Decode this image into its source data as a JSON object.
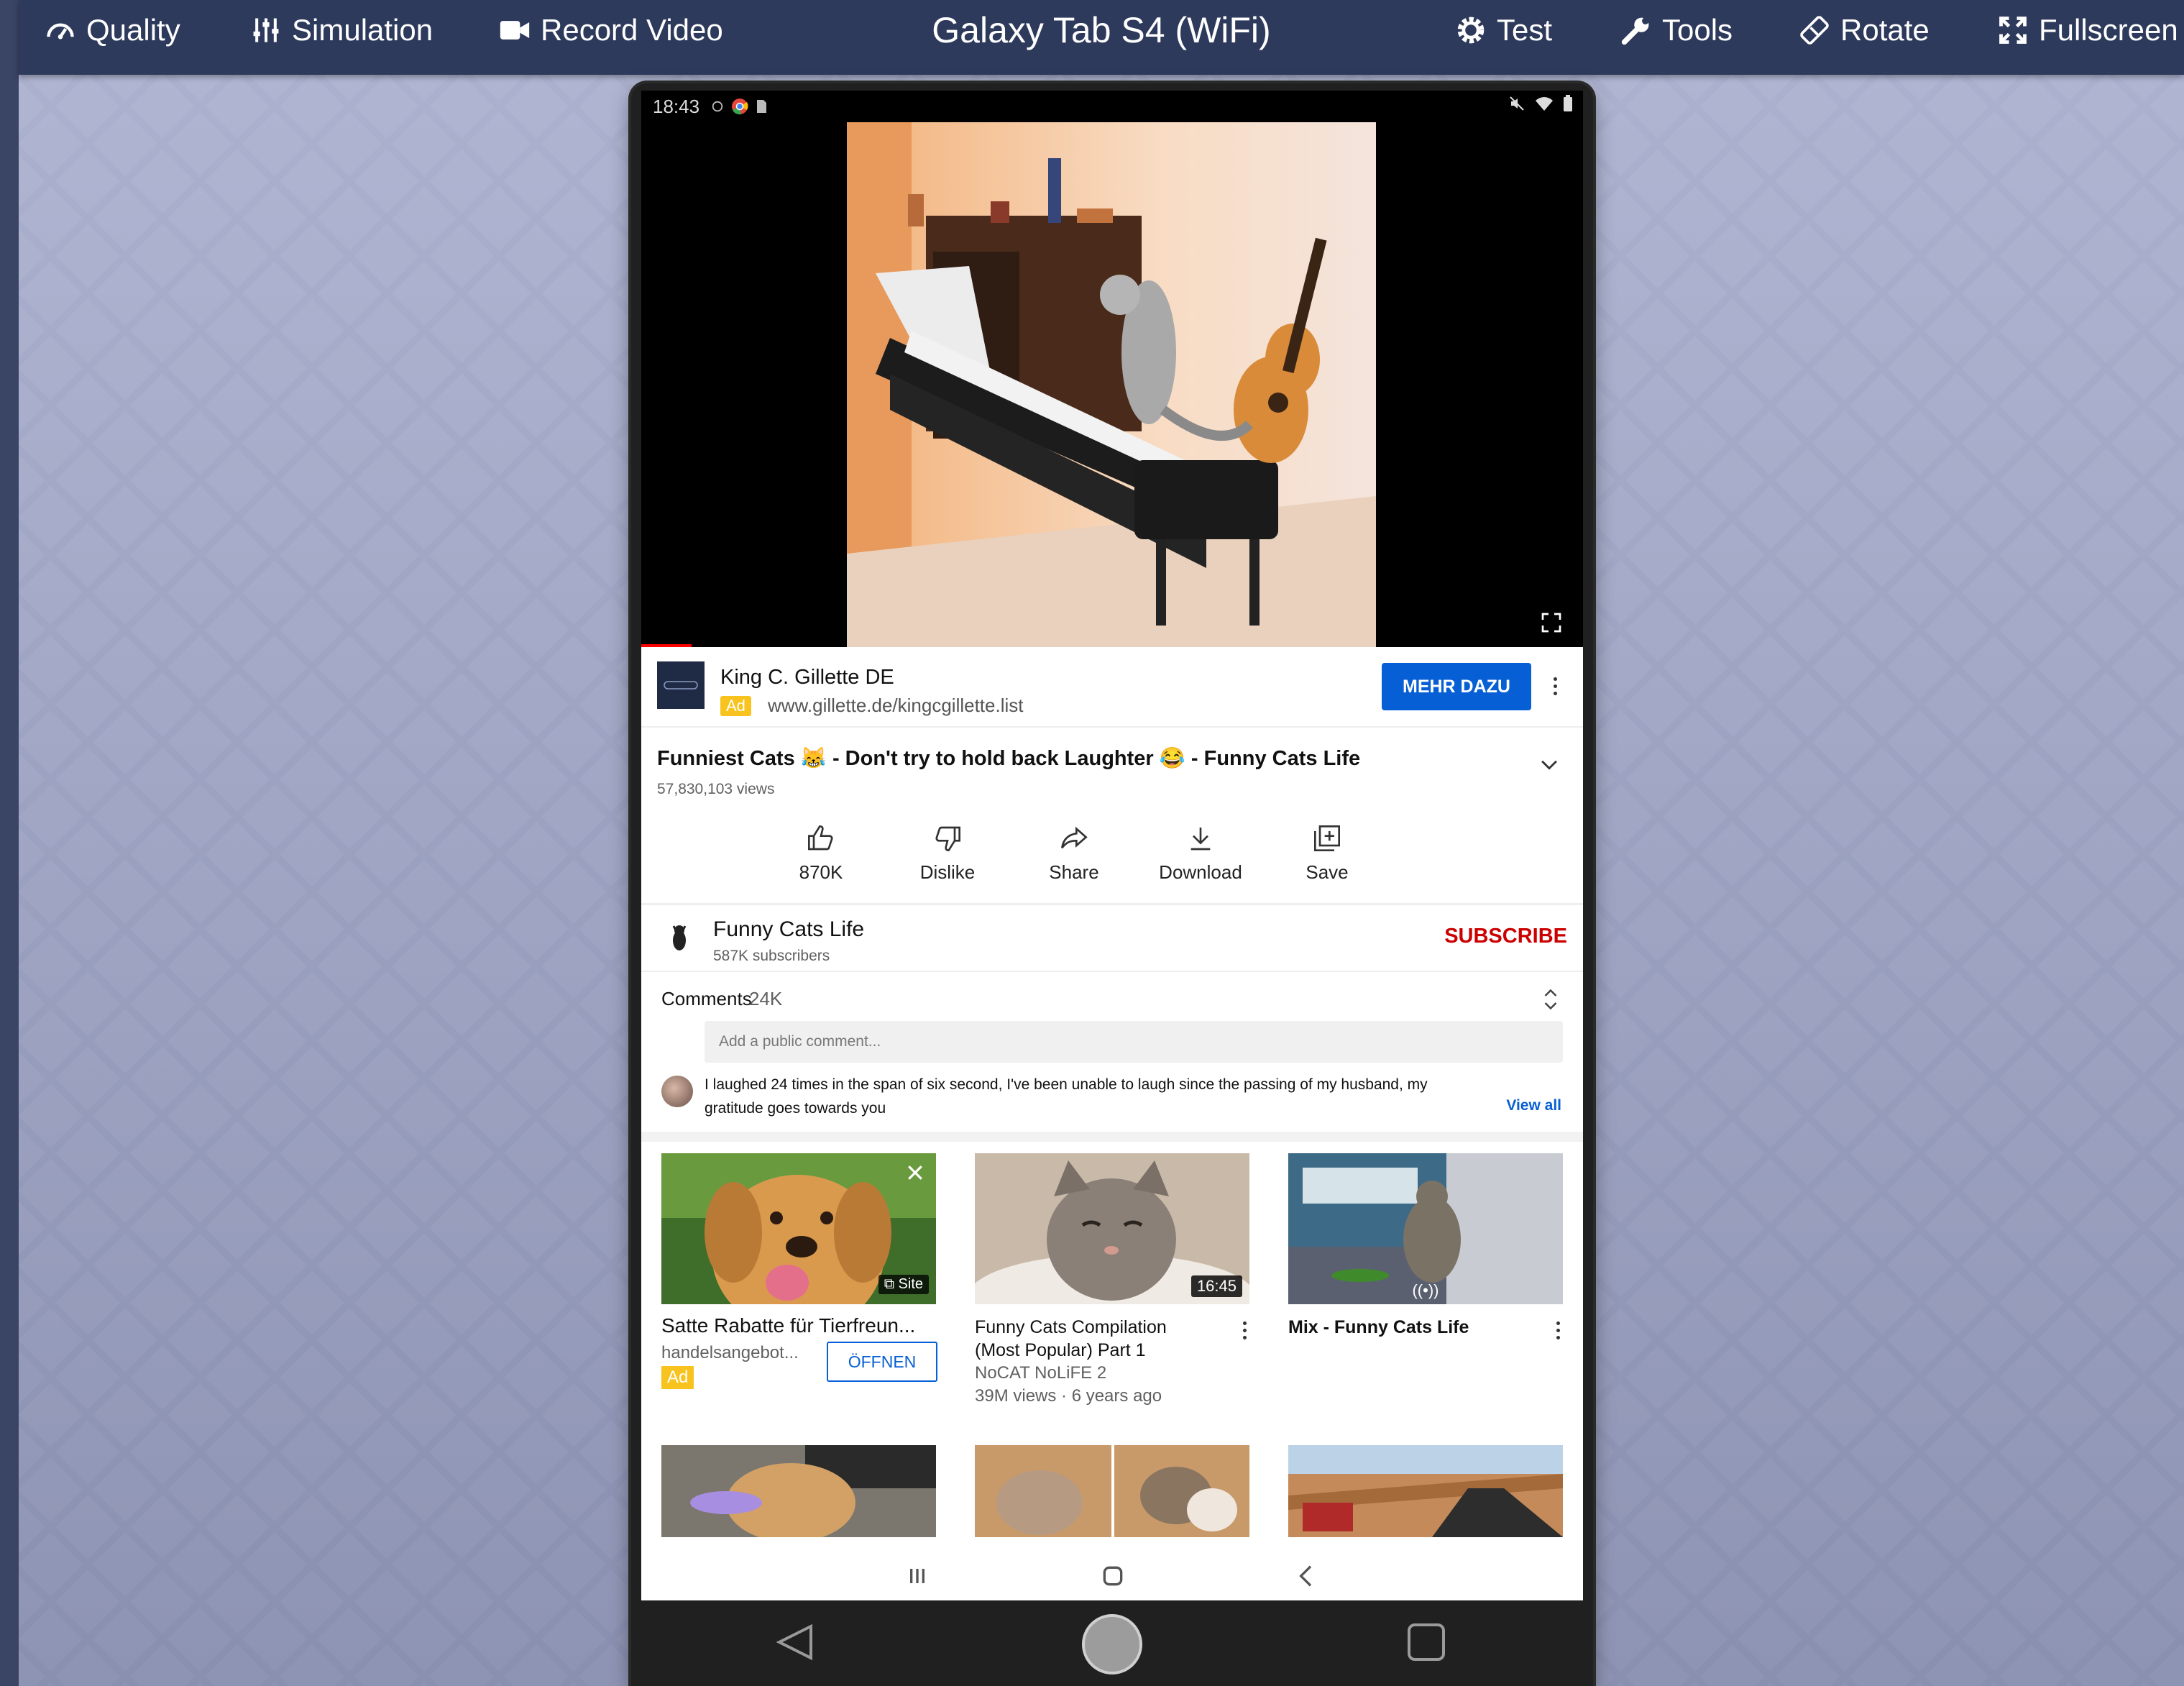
{
  "toolbar": {
    "quality": "Quality",
    "simulation": "Simulation",
    "record": "Record Video",
    "device_title": "Galaxy Tab S4 (WiFi)",
    "test": "Test",
    "tools": "Tools",
    "rotate": "Rotate",
    "fullscreen": "Fullscreen"
  },
  "status": {
    "time": "18:43"
  },
  "ad": {
    "name": "King C. Gillette DE",
    "badge": "Ad",
    "url": "www.gillette.de/kingcgillette.list",
    "cta": "MEHR DAZU"
  },
  "video": {
    "title": "Funniest Cats 😹 - Don't try to hold back Laughter 😂 - Funny Cats Life",
    "views": "57,830,103 views"
  },
  "actions": {
    "like": "870K",
    "dislike": "Dislike",
    "share": "Share",
    "download": "Download",
    "save": "Save"
  },
  "channel": {
    "name": "Funny Cats Life",
    "subscribers": "587K subscribers",
    "subscribe": "SUBSCRIBE"
  },
  "comments": {
    "label": "Comments",
    "count": "24K",
    "placeholder": "Add a public comment...",
    "top_comment": "I laughed 24 times in the span of six second, I've been unable to laugh since the passing of my husband, my gratitude goes towards you",
    "view_all": "View all"
  },
  "cards": {
    "ad": {
      "title": "Satte Rabatte für Tierfreun...",
      "advertiser": "handelsangebot...",
      "badge": "Ad",
      "cta": "ÖFFNEN",
      "site": "Site"
    },
    "video1": {
      "title": "Funny Cats Compilation (Most Popular) Part 1",
      "channel": "NoCAT NoLiFE 2",
      "meta": "39M views · 6 years ago",
      "duration": "16:45"
    },
    "mix": {
      "title": "Mix - Funny Cats Life",
      "live": "((•))"
    }
  },
  "colors": {
    "toolbar": "#2e3a5c",
    "accent_blue": "#065fd4",
    "subscribe_red": "#cc0000",
    "ad_yellow": "#f9c31f"
  }
}
